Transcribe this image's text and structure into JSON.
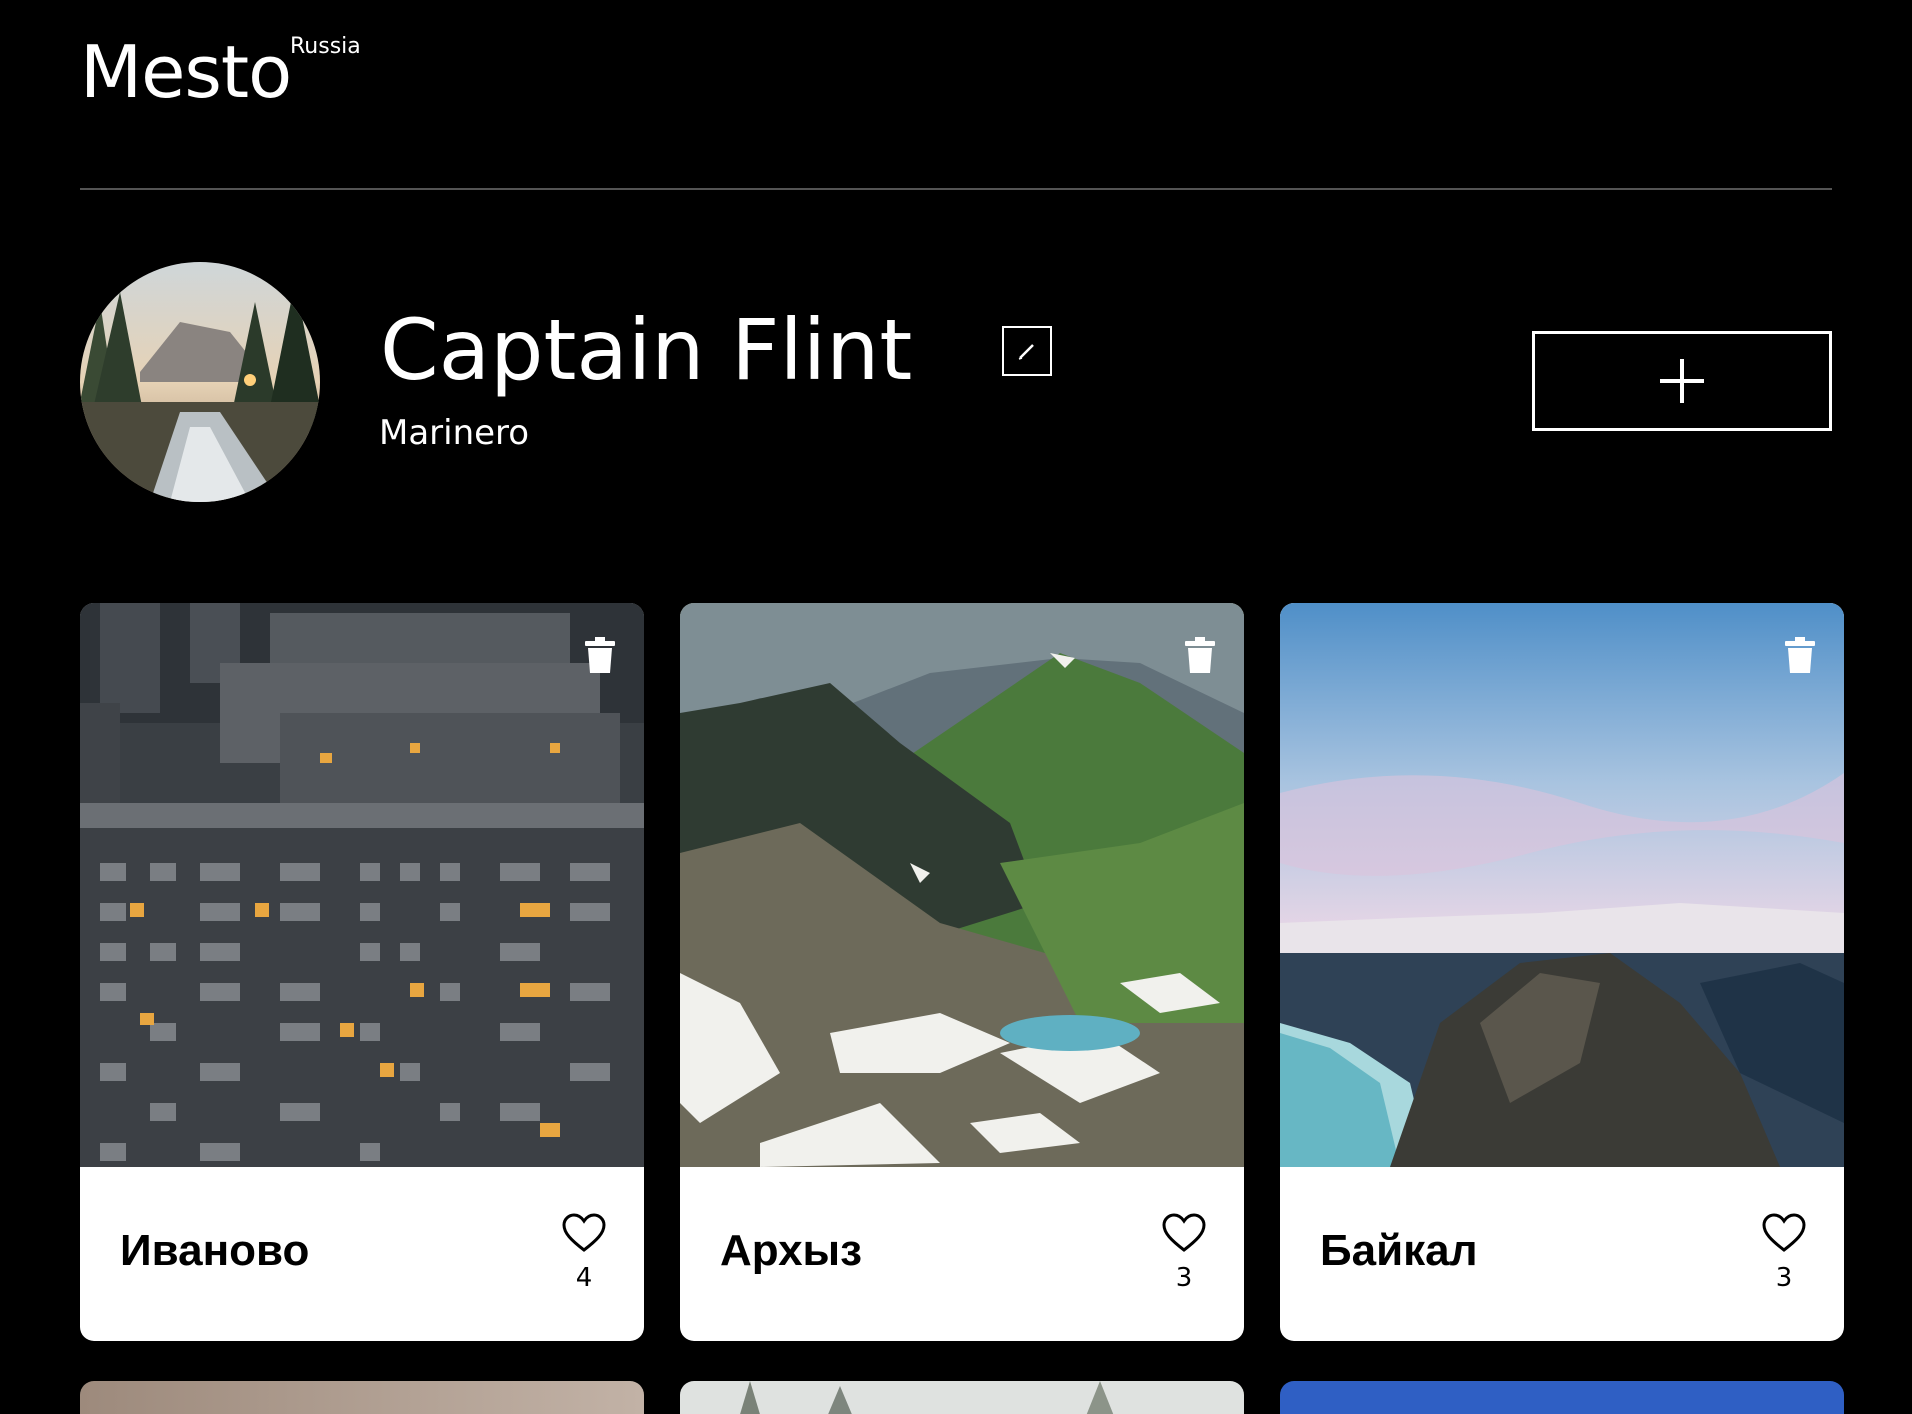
{
  "header": {
    "logo": "Mesto",
    "logo_sup": "Russia"
  },
  "profile": {
    "name": "Captain Flint",
    "about": "Marinero",
    "avatar_icon": "avatar-forest-river"
  },
  "cards": [
    {
      "title": "Иваново",
      "likes": "4",
      "image": "city-apartments"
    },
    {
      "title": "Архыз",
      "likes": "3",
      "image": "green-mountains"
    },
    {
      "title": "Байкал",
      "likes": "3",
      "image": "lake-baikal-cliff"
    }
  ],
  "partial_cards": [
    {
      "image": "warm-haze"
    },
    {
      "image": "foggy-trees"
    },
    {
      "image": "blue-sky"
    }
  ],
  "colors": {
    "background": "#000000",
    "card_bg": "#ffffff",
    "divider": "#545454"
  }
}
